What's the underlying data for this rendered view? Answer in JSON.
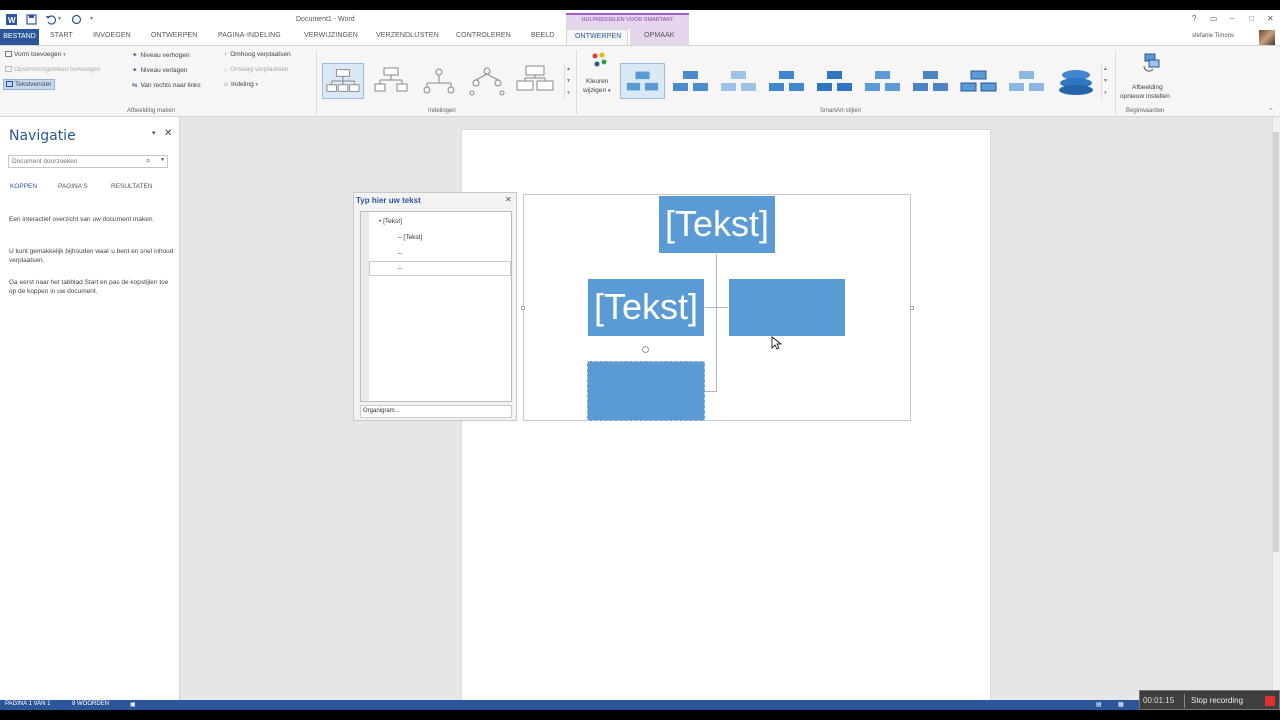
{
  "window": {
    "title": "Document1 - Word",
    "contextual_group": "HULPMIDDELEN VOOR SMARTART",
    "help": "?",
    "minimize": "–",
    "maximize": "□",
    "close": "✕",
    "user": "stefanie Timons"
  },
  "tabs": {
    "file": "BESTAND",
    "items": [
      "START",
      "INVOEGEN",
      "ONTWERPEN",
      "PAGINA-INDELING",
      "VERWIJZINGEN",
      "VERZENDLIJSTEN",
      "CONTROLEREN",
      "BEELD"
    ],
    "ctx_design": "ONTWERPEN",
    "ctx_format": "OPMAAK"
  },
  "ribbon": {
    "create": {
      "add_shape": "Vorm toevoegen",
      "add_bullet": "Opsommingsteken toevoegen",
      "text_pane": "Tekstvenster",
      "promote": "Niveau verhogen",
      "demote": "Niveau verlagen",
      "rtl": "Van rechts naar links",
      "move_up": "Omhoog verplaatsen",
      "move_down": "Omlaag verplaatsen",
      "layout": "Indeling",
      "group_label": "Afbeelding maken"
    },
    "layouts": {
      "group_label": "Indelingen"
    },
    "styles": {
      "colors_line1": "Kleuren",
      "colors_line2": "wijzigen",
      "group_label": "SmartArt-stijlen"
    },
    "reset": {
      "line1": "Afbeelding",
      "line2": "opnieuw instellen",
      "group_label": "Beginwaarden"
    }
  },
  "nav": {
    "title": "Navigatie",
    "search_placeholder": "Document doorzoeken",
    "tabs": [
      "KOPPEN",
      "PAGINA'S",
      "RESULTATEN"
    ],
    "text1": "Een interactief overzicht van uw document maken.",
    "text2": "U kunt gemakkelijk bijhouden waar u bent en snel inhoud verplaatsen.",
    "text3": "Ga eerst naar het tabblad Start en pas de kopstijlen toe op de koppen in uw document."
  },
  "textpane": {
    "title": "Typ hier uw tekst",
    "items": [
      "[Tekst]",
      "[Tekst]",
      "",
      ""
    ],
    "footer": "Organigram..."
  },
  "smartart": {
    "top": "[Tekst]",
    "left": "[Tekst]",
    "right": "",
    "bottom": ""
  },
  "status": {
    "page": "PAGINA 1 VAN 1",
    "words": "8 WOORDEN"
  },
  "recording": {
    "time": "00:01:15",
    "stop": "Stop recording"
  },
  "colors": {
    "accent": "#2b579a",
    "smartart_fill": "#5b9bd5",
    "contextual": "#a45bc9"
  }
}
